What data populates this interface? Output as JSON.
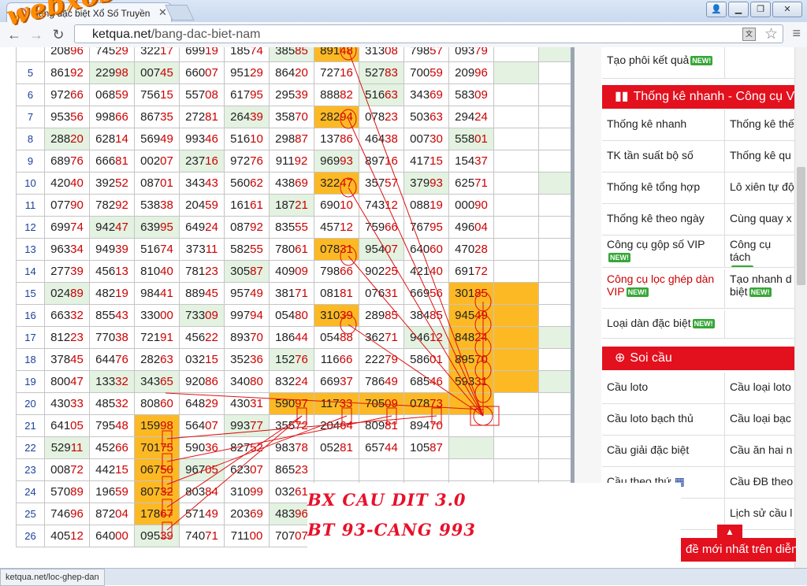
{
  "browser": {
    "tab_title": "Bảng đặc biệt Xổ Số Truyền",
    "url_host": "ketqua.net",
    "url_path": "/bang-dac-biet-nam",
    "watermark_logo": "webxoso.net",
    "status_url": "ketqua.net/loc-ghep-dan"
  },
  "table": {
    "rows": [
      {
        "idx": "",
        "cells": [
          "20896",
          "74529",
          "32217",
          "69919",
          "18574",
          "38585",
          "89148",
          "31308",
          "79857",
          "09379",
          "",
          ""
        ],
        "styles": [
          "e",
          "e",
          "e",
          "e",
          "e",
          "g",
          "o",
          "e",
          "e",
          "e",
          "e",
          "g"
        ]
      },
      {
        "idx": "5",
        "cells": [
          "86192",
          "22998",
          "00745",
          "66007",
          "95129",
          "86420",
          "72716",
          "52783",
          "70059",
          "20996",
          "",
          ""
        ],
        "styles": [
          "e",
          "g",
          "g",
          "e",
          "e",
          "e",
          "e",
          "g",
          "e",
          "e",
          "g",
          "e"
        ]
      },
      {
        "idx": "6",
        "cells": [
          "97266",
          "06859",
          "75615",
          "55708",
          "61795",
          "29539",
          "88882",
          "51663",
          "34369",
          "58309",
          "",
          ""
        ],
        "styles": [
          "e",
          "e",
          "e",
          "e",
          "e",
          "e",
          "e",
          "g",
          "e",
          "e",
          "e",
          "e"
        ]
      },
      {
        "idx": "7",
        "cells": [
          "95356",
          "99866",
          "86735",
          "27281",
          "26439",
          "35870",
          "28294",
          "07823",
          "50363",
          "29424",
          "",
          ""
        ],
        "styles": [
          "e",
          "e",
          "e",
          "e",
          "g",
          "e",
          "o",
          "e",
          "e",
          "e",
          "e",
          "e"
        ]
      },
      {
        "idx": "8",
        "cells": [
          "28820",
          "62814",
          "56949",
          "99346",
          "51610",
          "29887",
          "13786",
          "46438",
          "00730",
          "55801",
          "",
          ""
        ],
        "styles": [
          "g",
          "e",
          "e",
          "e",
          "e",
          "e",
          "e",
          "e",
          "e",
          "g",
          "e",
          "e"
        ]
      },
      {
        "idx": "9",
        "cells": [
          "68976",
          "66681",
          "00207",
          "23716",
          "97276",
          "91192",
          "96993",
          "89716",
          "41715",
          "15437",
          "",
          ""
        ],
        "styles": [
          "e",
          "e",
          "e",
          "g",
          "e",
          "e",
          "g",
          "e",
          "e",
          "e",
          "e",
          "e"
        ]
      },
      {
        "idx": "10",
        "cells": [
          "42040",
          "39252",
          "08701",
          "34343",
          "56062",
          "43869",
          "32247",
          "35757",
          "37993",
          "62571",
          "",
          ""
        ],
        "styles": [
          "e",
          "e",
          "e",
          "e",
          "e",
          "e",
          "o",
          "e",
          "g",
          "e",
          "e",
          "g"
        ]
      },
      {
        "idx": "11",
        "cells": [
          "07790",
          "78292",
          "53838",
          "20459",
          "16161",
          "18721",
          "69010",
          "74312",
          "08819",
          "00090",
          "",
          ""
        ],
        "styles": [
          "e",
          "e",
          "e",
          "e",
          "e",
          "g",
          "e",
          "e",
          "e",
          "e",
          "e",
          "e"
        ]
      },
      {
        "idx": "12",
        "cells": [
          "69974",
          "94247",
          "63995",
          "64924",
          "08792",
          "83555",
          "45712",
          "75966",
          "76795",
          "49604",
          "",
          ""
        ],
        "styles": [
          "e",
          "g",
          "g",
          "e",
          "e",
          "e",
          "e",
          "e",
          "e",
          "e",
          "e",
          "e"
        ]
      },
      {
        "idx": "13",
        "cells": [
          "96334",
          "94939",
          "51674",
          "37311",
          "58255",
          "78061",
          "07831",
          "95407",
          "64060",
          "47028",
          "",
          ""
        ],
        "styles": [
          "e",
          "e",
          "e",
          "e",
          "e",
          "e",
          "o",
          "g",
          "e",
          "e",
          "e",
          "e"
        ]
      },
      {
        "idx": "14",
        "cells": [
          "27739",
          "45613",
          "81040",
          "78123",
          "30587",
          "40909",
          "79866",
          "90225",
          "42140",
          "69172",
          "",
          ""
        ],
        "styles": [
          "e",
          "e",
          "e",
          "e",
          "g",
          "e",
          "e",
          "e",
          "e",
          "e",
          "e",
          "e"
        ]
      },
      {
        "idx": "15",
        "cells": [
          "02489",
          "48219",
          "98441",
          "88945",
          "95749",
          "38171",
          "08181",
          "07631",
          "66956",
          "30185",
          "",
          ""
        ],
        "styles": [
          "g",
          "e",
          "e",
          "e",
          "e",
          "e",
          "e",
          "e",
          "e",
          "o",
          "o",
          "e"
        ]
      },
      {
        "idx": "16",
        "cells": [
          "66332",
          "85543",
          "33000",
          "73309",
          "99794",
          "05480",
          "31039",
          "28985",
          "38485",
          "94549",
          "",
          ""
        ],
        "styles": [
          "e",
          "e",
          "e",
          "g",
          "e",
          "e",
          "o",
          "e",
          "e",
          "o",
          "o",
          "e"
        ]
      },
      {
        "idx": "17",
        "cells": [
          "81223",
          "77038",
          "72191",
          "45622",
          "89370",
          "18644",
          "05488",
          "36271",
          "94612",
          "84824",
          "",
          ""
        ],
        "styles": [
          "e",
          "e",
          "e",
          "e",
          "e",
          "e",
          "e",
          "e",
          "g",
          "o",
          "o",
          "g"
        ]
      },
      {
        "idx": "18",
        "cells": [
          "37845",
          "64476",
          "28263",
          "03215",
          "35236",
          "15276",
          "11666",
          "22279",
          "58601",
          "89570",
          "",
          ""
        ],
        "styles": [
          "e",
          "e",
          "e",
          "e",
          "e",
          "g",
          "e",
          "e",
          "e",
          "o",
          "o",
          "e"
        ]
      },
      {
        "idx": "19",
        "cells": [
          "80047",
          "13332",
          "34365",
          "92086",
          "34080",
          "83224",
          "66937",
          "78649",
          "68546",
          "59331",
          "",
          ""
        ],
        "styles": [
          "e",
          "g",
          "g",
          "e",
          "e",
          "e",
          "e",
          "e",
          "e",
          "o",
          "o",
          "g"
        ]
      },
      {
        "idx": "20",
        "cells": [
          "43033",
          "48532",
          "80860",
          "64829",
          "43031",
          "59097",
          "11733",
          "70509",
          "07873",
          "",
          "",
          ""
        ],
        "styles": [
          "e",
          "e",
          "e",
          "e",
          "e",
          "o",
          "o",
          "o",
          "o",
          "o",
          "e",
          "e"
        ]
      },
      {
        "idx": "21",
        "cells": [
          "64105",
          "79548",
          "15998",
          "56407",
          "99377",
          "35572",
          "20464",
          "80981",
          "89470",
          "",
          "",
          ""
        ],
        "styles": [
          "e",
          "e",
          "o",
          "e",
          "g",
          "e",
          "e",
          "e",
          "e",
          "e",
          "e",
          "e"
        ]
      },
      {
        "idx": "22",
        "cells": [
          "52911",
          "45266",
          "70175",
          "59036",
          "82752",
          "98378",
          "05281",
          "65744",
          "10587",
          "",
          "",
          ""
        ],
        "styles": [
          "g",
          "e",
          "o",
          "e",
          "e",
          "e",
          "e",
          "e",
          "e",
          "g",
          "e",
          "e"
        ]
      },
      {
        "idx": "23",
        "cells": [
          "00872",
          "44215",
          "06750",
          "96705",
          "62307",
          "86523",
          "",
          "",
          "",
          "",
          "",
          ""
        ],
        "styles": [
          "e",
          "e",
          "o",
          "g",
          "e",
          "e",
          "e",
          "e",
          "e",
          "e",
          "e",
          "e"
        ]
      },
      {
        "idx": "24",
        "cells": [
          "57089",
          "19659",
          "80732",
          "80384",
          "31099",
          "03261",
          "",
          "",
          "",
          "",
          "",
          ""
        ],
        "styles": [
          "e",
          "e",
          "o",
          "e",
          "e",
          "e",
          "e",
          "e",
          "e",
          "e",
          "e",
          "e"
        ]
      },
      {
        "idx": "25",
        "cells": [
          "74696",
          "87204",
          "17867",
          "57149",
          "20369",
          "48396",
          "",
          "",
          "",
          "",
          "",
          ""
        ],
        "styles": [
          "e",
          "e",
          "o",
          "e",
          "e",
          "g",
          "e",
          "e",
          "e",
          "e",
          "e",
          "e"
        ]
      },
      {
        "idx": "26",
        "cells": [
          "40512",
          "64000",
          "09539",
          "74071",
          "71100",
          "70707",
          "",
          "",
          "",
          "",
          "",
          ""
        ],
        "styles": [
          "e",
          "e",
          "g",
          "e",
          "e",
          "e",
          "e",
          "e",
          "e",
          "e",
          "e",
          "e"
        ]
      }
    ]
  },
  "sidebar": {
    "top_item": "Tạo phôi kết quả",
    "new_badge": "NEW!",
    "stats_header": "Thống kê nhanh - Công cụ VIP",
    "stats_items": [
      [
        "Thống kê nhanh",
        "Thống kê thế"
      ],
      [
        "TK tần suất bộ số",
        "Thống kê qu"
      ],
      [
        "Thống kê tổng hợp",
        "Lô xiên tự độ"
      ],
      [
        "Thống kê theo ngày",
        "Cùng quay x"
      ]
    ],
    "tool_gop": "Công cụ gộp số VIP",
    "tool_tach": "Công cụ tách",
    "tool_loc_1": "Công cụ lọc ghép dàn",
    "tool_loc_2": "VIP",
    "tool_taonhanh_1": "Tạo nhanh d",
    "tool_taonhanh_2": "biệt",
    "loai_dan": "Loại dàn đặc biệt",
    "soi_header": "Soi cầu",
    "soi_items": [
      [
        "Cầu loto",
        "Cầu loại loto"
      ],
      [
        "Cầu loto bạch thủ",
        "Cầu loại bạc"
      ],
      [
        "Cầu giải đặc biệt",
        "Cầu ăn hai n"
      ],
      [
        "Cầu theo thứ",
        "Cầu ĐB theo"
      ],
      [
        "",
        "Lịch sử cầu l"
      ]
    ],
    "news_bar": "đề mới nhất trên diễn"
  },
  "annotation": {
    "line1": "BX CAU DIT 3.0",
    "line2": "BT 93-CANG 993"
  }
}
